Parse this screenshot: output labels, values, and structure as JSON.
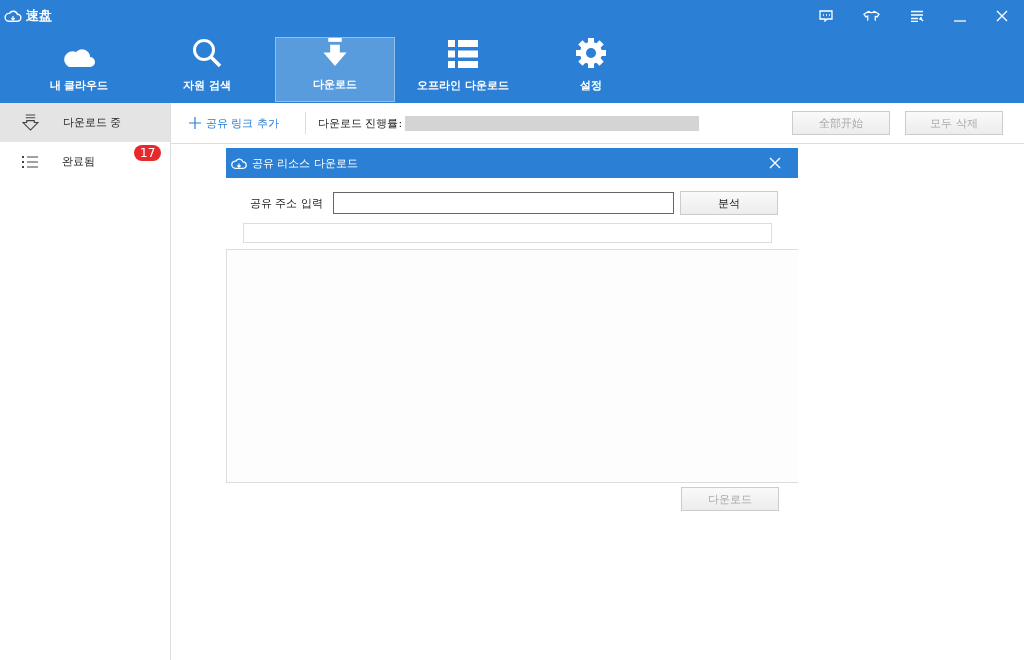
{
  "window": {
    "title": "速盘"
  },
  "nav_tabs": [
    {
      "label": "내 클라우드",
      "kind": "cloud",
      "selected": false
    },
    {
      "label": "자원 검색",
      "kind": "search",
      "selected": false
    },
    {
      "label": "다운로드",
      "kind": "download",
      "selected": true
    },
    {
      "label": "오프라인 다운로드",
      "kind": "list",
      "selected": false
    },
    {
      "label": "설정",
      "kind": "gear",
      "selected": false
    }
  ],
  "sidebar": {
    "items": [
      {
        "label": "다운로드 중",
        "kind": "downloading",
        "selected": true
      },
      {
        "label": "완료됨",
        "kind": "done",
        "selected": false,
        "badge": "17"
      }
    ]
  },
  "toolbar": {
    "add_link": "공유 링크 추가",
    "progress_label": "다운로드 진행률:",
    "buttons": [
      {
        "label": "全部开始",
        "disabled": true
      },
      {
        "label": "모두 삭제",
        "disabled": true
      }
    ]
  },
  "dialog": {
    "title": "공유 리소스 다운로드",
    "address_label": "공유 주소 입력",
    "analyze_button": "분석",
    "download_button": {
      "label": "다운로드",
      "disabled": true
    }
  }
}
